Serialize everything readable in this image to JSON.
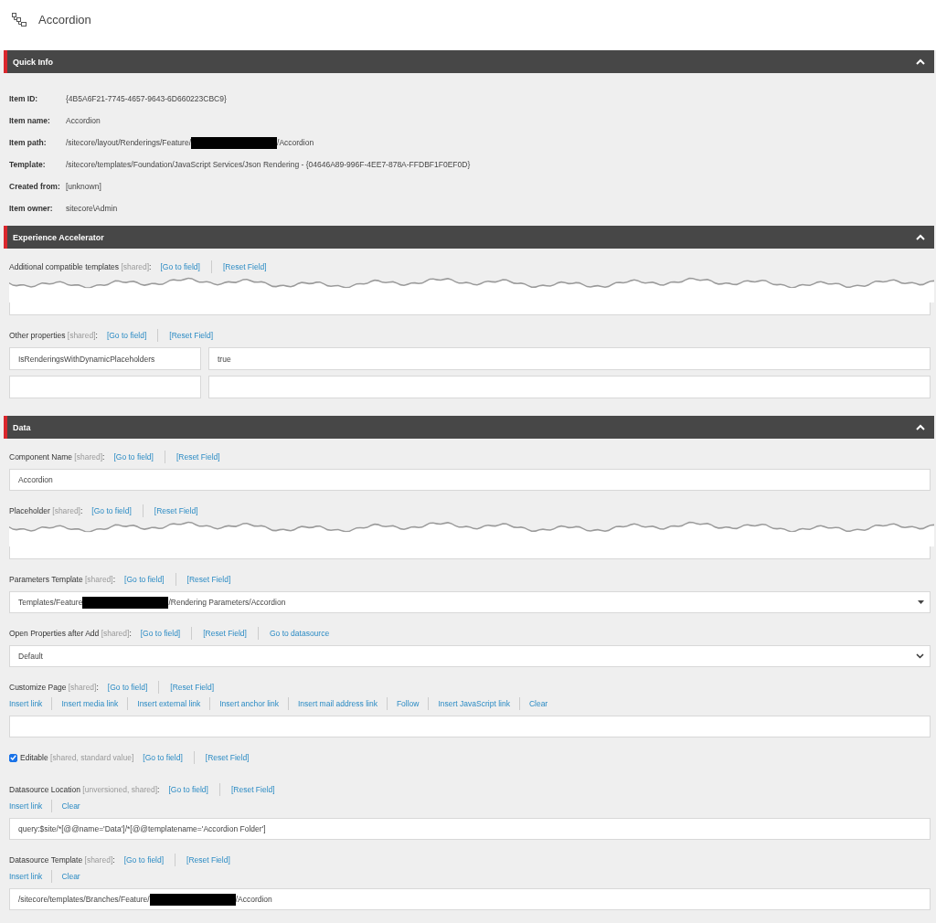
{
  "header": {
    "title": "Accordion"
  },
  "sections": [
    {
      "title": "Quick Info",
      "expanded": true,
      "kind": "info",
      "rows": [
        {
          "label": "Item ID:",
          "segments": [
            {
              "kind": "text",
              "text": "{4B5A6F21-7745-4657-9643-6D660223CBC9}"
            }
          ]
        },
        {
          "label": "Item name:",
          "segments": [
            {
              "kind": "text",
              "text": "Accordion"
            }
          ]
        },
        {
          "label": "Item path:",
          "segments": [
            {
              "kind": "text",
              "text": "/sitecore/layout/Renderings/Feature/"
            },
            {
              "kind": "redacted"
            },
            {
              "kind": "text",
              "text": "/Accordion"
            }
          ]
        },
        {
          "label": "Template:",
          "segments": [
            {
              "kind": "text",
              "text": "/sitecore/templates/Foundation/JavaScript Services/Json Rendering - {04646A89-996F-4EE7-878A-FFDBF1F0EF0D}"
            }
          ]
        },
        {
          "label": "Created from:",
          "segments": [
            {
              "kind": "text",
              "text": "[unknown]"
            }
          ]
        },
        {
          "label": "Item owner:",
          "segments": [
            {
              "kind": "text",
              "text": "sitecore\\Admin"
            }
          ]
        }
      ]
    },
    {
      "title": "Experience Accelerator",
      "expanded": true,
      "kind": "fields",
      "fields": [
        {
          "kind": "torn",
          "label": "Additional compatible templates *[shared]*:",
          "actions": [
            "[Go to field]",
            "[Reset Field]"
          ]
        },
        {
          "kind": "pairs",
          "label": "Other properties *[shared]*:",
          "actions": [
            "[Go to field]",
            "[Reset Field]"
          ],
          "pairs": [
            {
              "kind": "filled",
              "key": "IsRenderingsWithDynamicPlaceholders",
              "value": "true"
            },
            {
              "kind": "blank"
            }
          ]
        }
      ]
    },
    {
      "title": "Data",
      "expanded": true,
      "kind": "fields",
      "fields": [
        {
          "kind": "text",
          "label": "Component Name *[shared]*:",
          "actions": [
            "[Go to field]",
            "[Reset Field]"
          ],
          "segments": [
            {
              "kind": "text",
              "text": "Accordion"
            }
          ]
        },
        {
          "kind": "torn",
          "label": "Placeholder *[shared]*:",
          "actions": [
            "[Go to field]",
            "[Reset Field]"
          ]
        },
        {
          "kind": "combo",
          "label": "Parameters Template *[shared]*:",
          "actions": [
            "[Go to field]",
            "[Reset Field]"
          ],
          "segments": [
            {
              "kind": "text",
              "text": "Templates/Feature"
            },
            {
              "kind": "redacted"
            },
            {
              "kind": "text",
              "text": "/Rendering Parameters/Accordion"
            }
          ]
        },
        {
          "kind": "select",
          "label": "Open Properties after Add *[shared]*:",
          "actions": [
            "[Go to field]",
            "[Reset Field]",
            "Go to datasource"
          ],
          "segments": [
            {
              "kind": "text",
              "text": "Default"
            }
          ]
        },
        {
          "kind": "text",
          "label": "Customize Page *[shared]*:",
          "actions": [
            "[Go to field]",
            "[Reset Field]"
          ],
          "tools": [
            "Insert link",
            "Insert media link",
            "Insert external link",
            "Insert anchor link",
            "Insert mail address link",
            "Follow",
            "Insert JavaScript link",
            "Clear"
          ]
        },
        {
          "kind": "checkbox",
          "checked": true,
          "label": "Editable *[shared, standard value]*",
          "actions": [
            "[Go to field]",
            "[Reset Field]"
          ]
        },
        {
          "kind": "text",
          "label": "Datasource Location *[unversioned, shared]*:",
          "actions": [
            "[Go to field]",
            "[Reset Field]"
          ],
          "tools": [
            "Insert link",
            "Clear"
          ],
          "segments": [
            {
              "kind": "text",
              "text": "query:$site/*[@@name='Data']/*[@@templatename='Accordion Folder']"
            }
          ]
        },
        {
          "kind": "text",
          "label": "Datasource Template *[shared]*:",
          "actions": [
            "[Go to field]",
            "[Reset Field]"
          ],
          "tools": [
            "Insert link",
            "Clear"
          ],
          "segments": [
            {
              "kind": "text",
              "text": "/sitecore/templates/Branches/Feature/"
            },
            {
              "kind": "redacted"
            },
            {
              "kind": "text",
              "text": "/Accordion"
            }
          ]
        }
      ]
    }
  ]
}
